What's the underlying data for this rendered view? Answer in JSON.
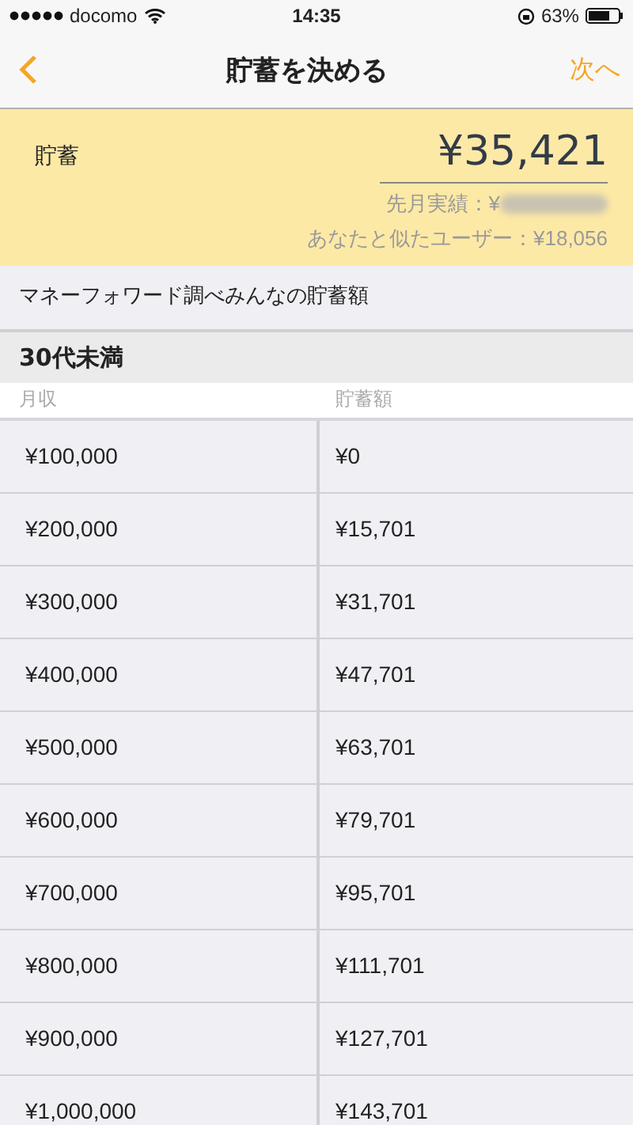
{
  "status_bar": {
    "carrier": "docomo",
    "time": "14:35",
    "battery": "63%"
  },
  "nav": {
    "title": "貯蓄を決める",
    "next": "次へ"
  },
  "savings": {
    "label": "貯蓄",
    "value": "¥35,421",
    "last_month_label": "先月実績：¥",
    "similar_users": "あなたと似たユーザー：¥18,056"
  },
  "section_title": "マネーフォワード調べみんなの貯蓄額",
  "group": {
    "title": "30代未満",
    "columns": [
      "月収",
      "貯蓄額"
    ],
    "rows": [
      [
        "¥100,000",
        "¥0"
      ],
      [
        "¥200,000",
        "¥15,701"
      ],
      [
        "¥300,000",
        "¥31,701"
      ],
      [
        "¥400,000",
        "¥47,701"
      ],
      [
        "¥500,000",
        "¥63,701"
      ],
      [
        "¥600,000",
        "¥79,701"
      ],
      [
        "¥700,000",
        "¥95,701"
      ],
      [
        "¥800,000",
        "¥111,701"
      ],
      [
        "¥900,000",
        "¥127,701"
      ],
      [
        "¥1,000,000",
        "¥143,701"
      ]
    ]
  }
}
